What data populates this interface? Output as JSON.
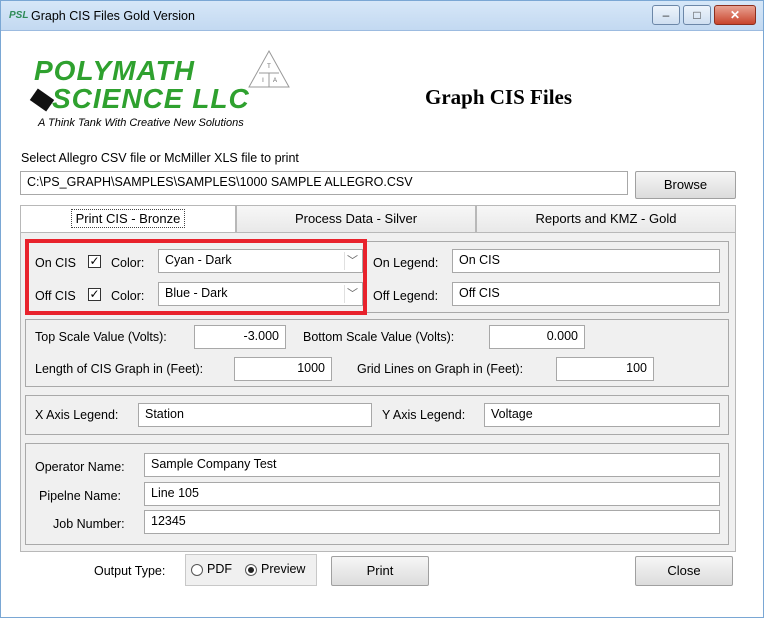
{
  "window": {
    "title": "Graph CIS Files Gold Version",
    "icon_label": "PSL",
    "buttons": {
      "minimize": "–",
      "maximize": "□",
      "close": "✕"
    }
  },
  "logo": {
    "line1": "POLYMATH",
    "line2": "SCIENCE LLC",
    "tagline": "A Think Tank With Creative New Solutions",
    "triangle_letters": [
      "T",
      "I",
      "A"
    ]
  },
  "header": {
    "title": "Graph CIS Files"
  },
  "file": {
    "label": "Select Allegro CSV file or McMiller XLS file to print",
    "path": "C:\\PS_GRAPH\\SAMPLES\\SAMPLES\\1000 SAMPLE ALLEGRO.CSV",
    "browse_label": "Browse"
  },
  "tabs": [
    {
      "label": "Print CIS - Bronze",
      "active": true
    },
    {
      "label": "Process Data - Silver",
      "active": false
    },
    {
      "label": "Reports and KMZ - Gold",
      "active": false
    }
  ],
  "cis": {
    "on": {
      "label": "On CIS",
      "checked": "✓",
      "color_label": "Color:",
      "color_value": "Cyan - Dark",
      "legend_label": "On Legend:",
      "legend_value": "On CIS"
    },
    "off": {
      "label": "Off CIS",
      "checked": "✓",
      "color_label": "Color:",
      "color_value": "Blue - Dark",
      "legend_label": "Off Legend:",
      "legend_value": "Off CIS"
    }
  },
  "scale": {
    "top_label": "Top Scale Value (Volts):",
    "top_value": "-3.000",
    "bottom_label": "Bottom Scale Value (Volts):",
    "bottom_value": "0.000",
    "length_label": "Length of CIS Graph in (Feet):",
    "length_value": "1000",
    "grid_label": "Grid Lines on Graph in (Feet):",
    "grid_value": "100"
  },
  "axis": {
    "x_label": "X Axis Legend:",
    "x_value": "Station",
    "y_label": "Y Axis Legend:",
    "y_value": "Voltage"
  },
  "info": {
    "operator_label": "Operator Name:",
    "operator_value": "Sample Company Test",
    "pipeline_label": "Pipelne Name:",
    "pipeline_value": "Line 105",
    "job_label": "Job Number:",
    "job_value": "12345"
  },
  "output": {
    "label": "Output Type:",
    "pdf_label": "PDF",
    "preview_label": "Preview",
    "selected": "Preview"
  },
  "actions": {
    "print_label": "Print",
    "close_label": "Close"
  },
  "colors": {
    "highlight": "#e8222c",
    "logo_green": "#2fa12f"
  }
}
